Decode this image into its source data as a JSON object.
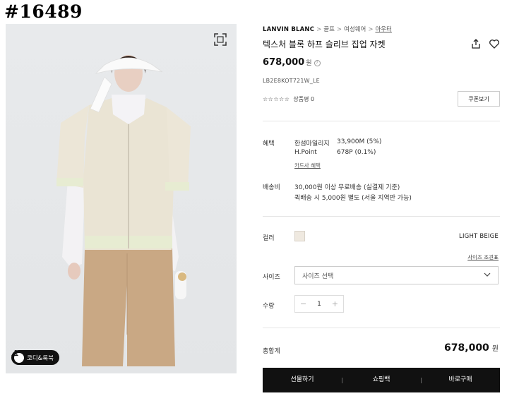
{
  "overlay_id": "#16489",
  "gallery": {
    "badge_label": "코디&룩북",
    "fullscreen_icon": "fullscreen-icon"
  },
  "breadcrumb": {
    "brand": "LANVIN BLANC",
    "items": [
      "골프",
      "여성웨어",
      "아우터"
    ],
    "separator": ">"
  },
  "product": {
    "title": "텍스처 블록 하프 슬리브 집업 자켓",
    "price": "678,000",
    "currency": "원",
    "code": "LB2E8KOT721W_LE",
    "stars": "☆☆☆☆☆",
    "review_label": "상품평 0"
  },
  "coupon_button": "쿠폰보기",
  "benefits": {
    "label": "혜택",
    "rows": [
      {
        "name": "한섬마일리지",
        "value": "33,900M (5%)"
      },
      {
        "name": "H.Point",
        "value": "678P (0.1%)"
      }
    ],
    "card_link": "카드사 혜택"
  },
  "shipping": {
    "label": "배송비",
    "line1": "30,000원 이상 무료배송 (실결제 기준)",
    "line2": "퀵배송 시 5,000원 별도 (서울 지역만 가능)"
  },
  "color": {
    "label": "컬러",
    "name": "LIGHT BEIGE",
    "swatch": "#efe9e0"
  },
  "size": {
    "guide_link": "사이즈 조견표",
    "label": "사이즈",
    "placeholder": "사이즈 선택"
  },
  "quantity": {
    "label": "수량",
    "value": "1",
    "minus": "−",
    "plus": "+"
  },
  "total": {
    "label": "총합계",
    "price": "678,000",
    "currency": "원"
  },
  "actions": [
    "선물하기",
    "쇼핑백",
    "바로구매"
  ]
}
